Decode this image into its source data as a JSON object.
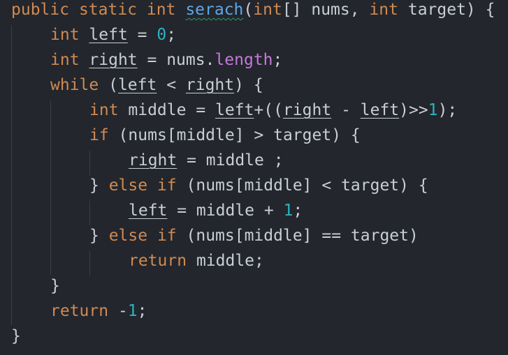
{
  "code": {
    "line1": {
      "kw_public": "public",
      "kw_static": "static",
      "kw_int": "int",
      "method_name": "serach",
      "paren_open": "(",
      "kw_int2": "int",
      "array_brackets": "[]",
      "param_nums": " nums, ",
      "kw_int3": "int",
      "param_target": " target) {"
    },
    "line2": {
      "kw_int": "int",
      "var_left": "left",
      "op": " = ",
      "num_zero": "0",
      "semi": ";"
    },
    "line3": {
      "kw_int": "int",
      "var_right": "right",
      "op": " = nums.",
      "prop_length": "length",
      "semi": ";"
    },
    "line4": {
      "kw_while": "while",
      "open": " (",
      "var_left": "left",
      "op": " < ",
      "var_right": "right",
      "close": ") {"
    },
    "line5": {
      "kw_int": "int",
      "text1": " middle = ",
      "var_left": "left",
      "text2": "+((",
      "var_right": "right",
      "text3": " - ",
      "var_left2": "left",
      "text4": ")>>",
      "num_one": "1",
      "text5": ");"
    },
    "line6": {
      "kw_if": "if",
      "text": " (nums[middle] > target) {"
    },
    "line7": {
      "var_right": "right",
      "text": " = middle ;"
    },
    "line8": {
      "brace": "} ",
      "kw_else": "else",
      "kw_if": "if",
      "text": " (nums[middle] < target) {"
    },
    "line9": {
      "var_left": "left",
      "text": " = middle + ",
      "num_one": "1",
      "semi": ";"
    },
    "line10": {
      "brace": "} ",
      "kw_else": "else",
      "kw_if": "if",
      "text": " (nums[middle] == target)"
    },
    "line11": {
      "kw_return": "return",
      "text": " middle;"
    },
    "line12": {
      "brace": "}"
    },
    "line13": {
      "kw_return": "return",
      "text": " -",
      "num_one": "1",
      "semi": ";"
    },
    "line14": {
      "brace": "}"
    }
  },
  "colors": {
    "background": "#23262c",
    "keyword": "#d08a53",
    "function": "#5ea7e6",
    "number": "#27b5c3",
    "property": "#c678dd",
    "text": "#c9ced6"
  }
}
